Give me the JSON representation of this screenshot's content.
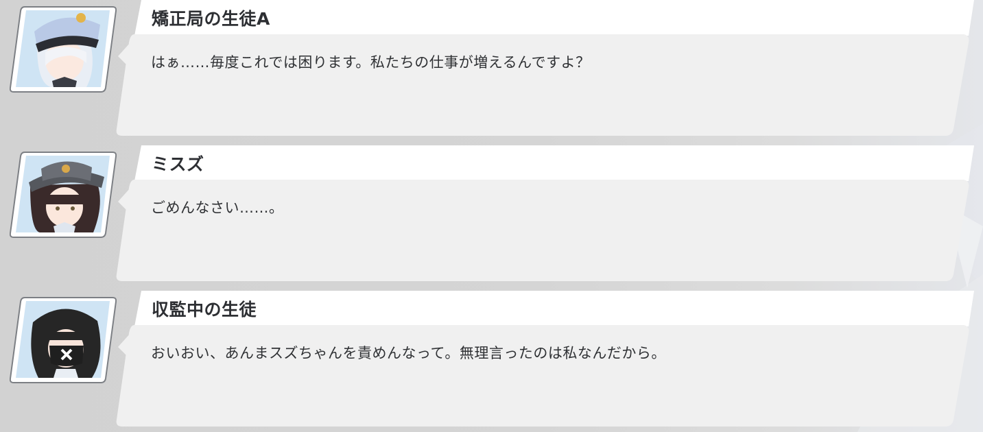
{
  "log": [
    {
      "speaker": "矯正局の生徒A",
      "text": "はぁ……毎度これでは困ります。私たちの仕事が増えるんですよ？",
      "portrait_icon": "student-police-cap-portrait"
    },
    {
      "speaker": "ミスズ",
      "text": "ごめんなさい……。",
      "portrait_icon": "misuzu-portrait"
    },
    {
      "speaker": "収監中の生徒",
      "text": "おいおい、あんまスズちゃんを責めんなって。無理言ったのは私なんだから。",
      "portrait_icon": "masked-student-portrait"
    }
  ],
  "colors": {
    "background": "#d4d4d4",
    "bubble_header": "#ffffff",
    "bubble_body": "#f0f0f0",
    "text": "#2f3134"
  }
}
